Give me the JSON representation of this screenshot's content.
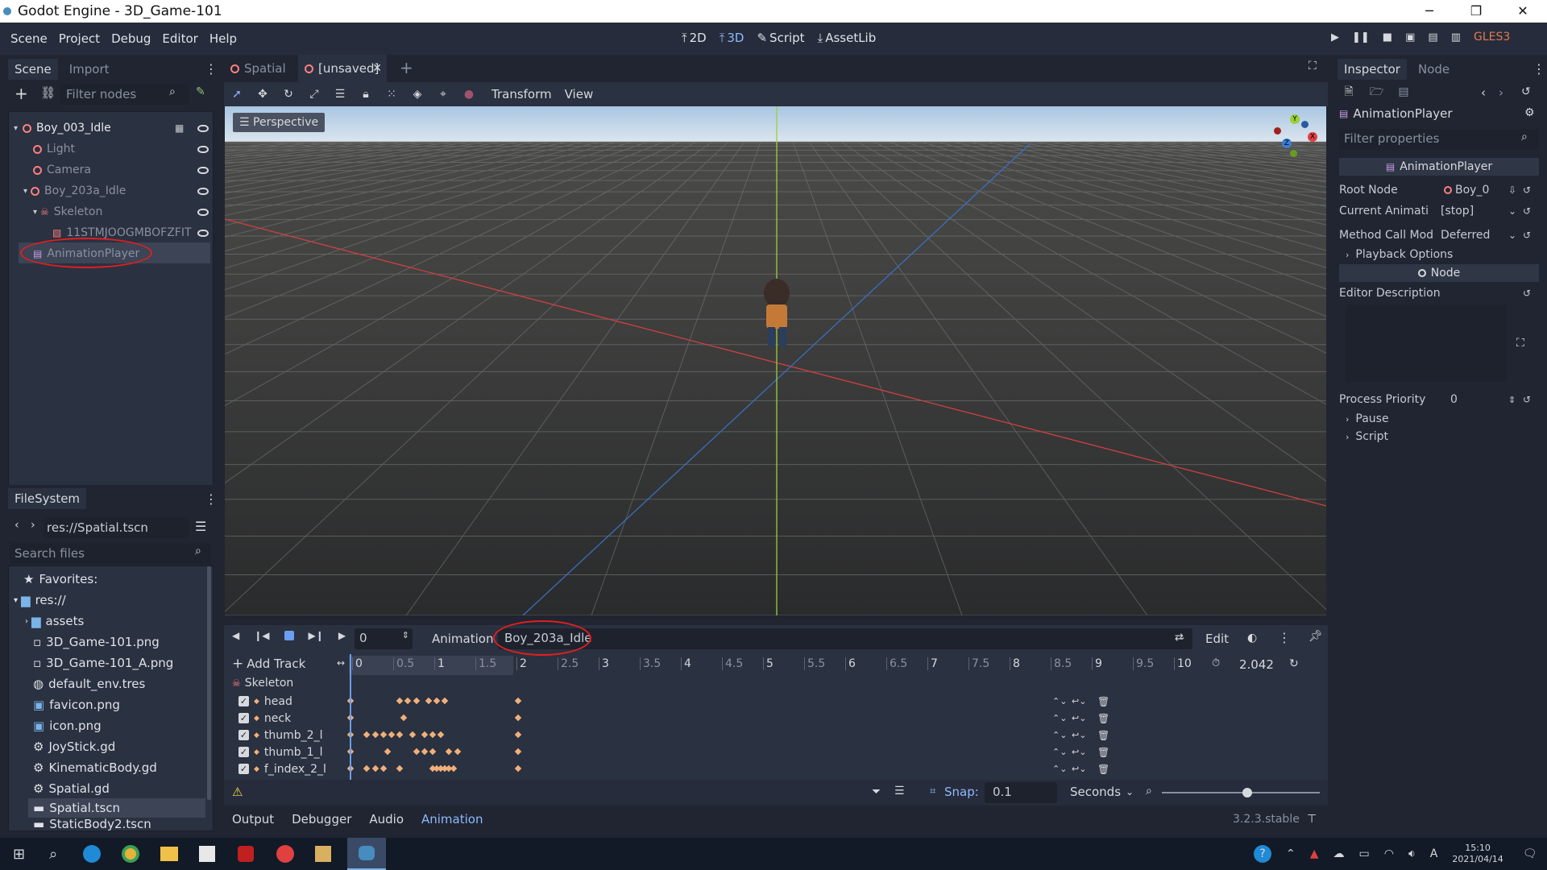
{
  "window": {
    "title": "Godot Engine - 3D_Game-101",
    "minimize": "─",
    "maximize": "❐",
    "close": "✕"
  },
  "menubar": {
    "menus": [
      "Scene",
      "Project",
      "Debug",
      "Editor",
      "Help"
    ],
    "modes": [
      {
        "icon": "⤒",
        "label": "2D"
      },
      {
        "icon": "⤒",
        "label": "3D"
      },
      {
        "icon": "✎",
        "label": "Script"
      },
      {
        "icon": "⤓",
        "label": "AssetLib"
      }
    ],
    "renderer": "GLES3"
  },
  "scene_dock": {
    "tabs": [
      "Scene",
      "Import"
    ],
    "filter_placeholder": "Filter nodes",
    "nodes": [
      {
        "label": "Boy_003_Idle",
        "indent": 0
      },
      {
        "label": "Light",
        "indent": 1
      },
      {
        "label": "Camera",
        "indent": 1
      },
      {
        "label": "Boy_203a_Idle",
        "indent": 1
      },
      {
        "label": "Skeleton",
        "indent": 2
      },
      {
        "label": "11STMJOOGMBOFZFIT",
        "indent": 3
      },
      {
        "label": "AnimationPlayer",
        "indent": 1
      }
    ]
  },
  "filesystem": {
    "title": "FileSystem",
    "path": "res://Spatial.tscn",
    "search_placeholder": "Search files",
    "items": [
      {
        "label": "Favorites:",
        "icon": "★"
      },
      {
        "label": "res://",
        "icon": "▆"
      },
      {
        "label": "assets",
        "icon": "▆"
      },
      {
        "label": "3D_Game-101.png",
        "icon": "▫"
      },
      {
        "label": "3D_Game-101_A.png",
        "icon": "▫"
      },
      {
        "label": "default_env.tres",
        "icon": "◍"
      },
      {
        "label": "favicon.png",
        "icon": "▣"
      },
      {
        "label": "icon.png",
        "icon": "▣"
      },
      {
        "label": "JoyStick.gd",
        "icon": "⚙"
      },
      {
        "label": "KinematicBody.gd",
        "icon": "⚙"
      },
      {
        "label": "Spatial.gd",
        "icon": "⚙"
      },
      {
        "label": "Spatial.tscn",
        "icon": "▬"
      },
      {
        "label": "StaticBody2.tscn",
        "icon": "▬"
      }
    ]
  },
  "viewport": {
    "tabs": [
      "Spatial",
      "[unsaved]"
    ],
    "toolbar_menus": [
      "Transform",
      "View"
    ],
    "perspective_label": "Perspective",
    "gizmo": {
      "x": "X",
      "y": "Y",
      "z": "Z"
    }
  },
  "animation": {
    "frame": "0",
    "animation_label": "Animation",
    "current": "Boy_203a_Idle",
    "edit_label": "Edit",
    "add_track": "Add Track",
    "ticks": [
      "0",
      "0.5",
      "1",
      "1.5",
      "2",
      "2.5",
      "3",
      "3.5",
      "4",
      "4.5",
      "5",
      "5.5",
      "6",
      "6.5",
      "7",
      "7.5",
      "8",
      "8.5",
      "9",
      "9.5",
      "10"
    ],
    "length": "2.042",
    "group": "Skeleton",
    "tracks": [
      "head",
      "neck",
      "thumb_2_l",
      "thumb_1_l",
      "f_index_2_l"
    ],
    "keyframe_times": [
      [
        0,
        0.6,
        0.7,
        0.8,
        0.95,
        1.05,
        1.15,
        2.042
      ],
      [
        0,
        0.65,
        2.042
      ],
      [
        0,
        0.2,
        0.3,
        0.4,
        0.5,
        0.6,
        0.75,
        0.9,
        1.0,
        1.1,
        2.042
      ],
      [
        0,
        0.45,
        0.8,
        0.9,
        1.0,
        1.2,
        1.3,
        2.042
      ],
      [
        0,
        0.2,
        0.3,
        0.4,
        0.6,
        1.0,
        1.05,
        1.1,
        1.15,
        1.2,
        1.25,
        2.042
      ]
    ],
    "snap_label": "Snap:",
    "snap_value": "0.1",
    "units": "Seconds"
  },
  "bottom_tabs": [
    "Output",
    "Debugger",
    "Audio",
    "Animation"
  ],
  "version": "3.2.3.stable",
  "inspector": {
    "tabs": [
      "Inspector",
      "Node"
    ],
    "object": "AnimationPlayer",
    "filter_placeholder": "Filter properties",
    "class_header": "AnimationPlayer",
    "props": [
      {
        "name": "Root Node",
        "value": "Boy_0"
      },
      {
        "name": "Current Animati",
        "value": "[stop]"
      },
      {
        "name": "Method Call Mod",
        "value": "Deferred"
      }
    ],
    "playback_options": "Playback Options",
    "node_header": "Node",
    "editor_description": "Editor Description",
    "process_priority": {
      "name": "Process Priority",
      "value": "0"
    },
    "sections": [
      "Pause",
      "Script"
    ]
  },
  "taskbar": {
    "time": "15:10",
    "date": "2021/04/14",
    "lang": "A"
  },
  "colors": {
    "accent": "#8eb8ff",
    "annotation": "#e01f1f",
    "keyframe": "#f0b07a",
    "x_axis": "#e0403f",
    "y_axis": "#9ad03a",
    "z_axis": "#3a7fd6"
  }
}
